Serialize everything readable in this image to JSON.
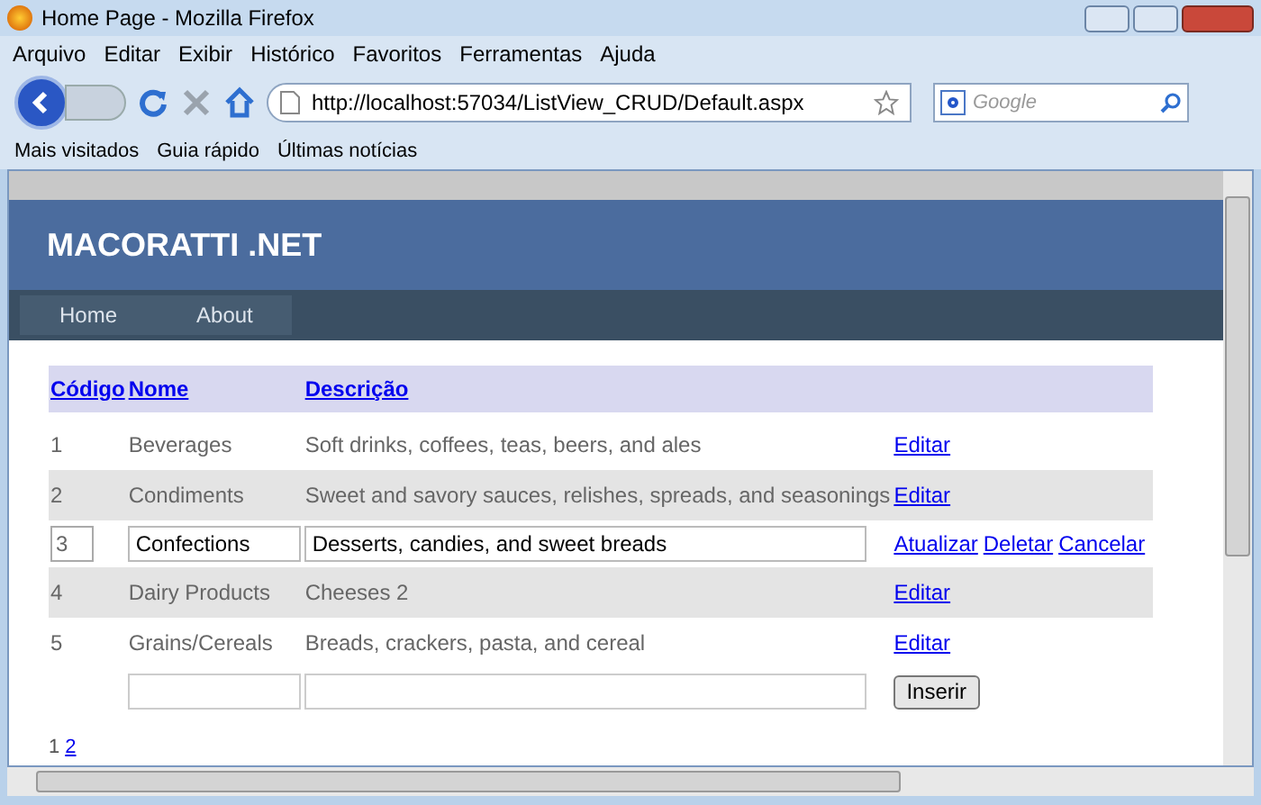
{
  "window": {
    "title": "Home Page - Mozilla Firefox"
  },
  "menu": [
    "Arquivo",
    "Editar",
    "Exibir",
    "Histórico",
    "Favoritos",
    "Ferramentas",
    "Ajuda"
  ],
  "address_bar": {
    "value": "http://localhost:57034/ListView_CRUD/Default.aspx"
  },
  "search": {
    "placeholder": "Google"
  },
  "bookmarks": [
    "Mais visitados",
    "Guia rápido",
    "Últimas notícias"
  ],
  "site": {
    "logo": "MACORATTI .NET",
    "nav": [
      "Home",
      "About"
    ]
  },
  "table": {
    "columns": [
      "Código",
      "Nome",
      "Descrição"
    ],
    "rows": [
      {
        "kind": "view",
        "shaded": false,
        "cells": [
          "1",
          "Beverages",
          "Soft drinks, coffees, teas, beers, and ales"
        ],
        "actions": [
          "Editar"
        ]
      },
      {
        "kind": "view",
        "shaded": true,
        "cells": [
          "2",
          "Condiments",
          "Sweet and savory sauces, relishes, spreads, and seasonings"
        ],
        "actions": [
          "Editar"
        ]
      },
      {
        "kind": "edit",
        "shaded": false,
        "cells": [
          "3",
          "Confections",
          "Desserts, candies, and sweet breads"
        ],
        "actions": [
          "Atualizar",
          "Deletar",
          "Cancelar"
        ]
      },
      {
        "kind": "view",
        "shaded": true,
        "cells": [
          "4",
          "Dairy Products",
          "Cheeses 2"
        ],
        "actions": [
          "Editar"
        ]
      },
      {
        "kind": "view",
        "shaded": false,
        "cells": [
          "5",
          "Grains/Cereals",
          "Breads, crackers, pasta, and cereal"
        ],
        "actions": [
          "Editar"
        ]
      },
      {
        "kind": "insert",
        "shaded": false,
        "button": "Inserir"
      }
    ]
  },
  "pager": [
    {
      "label": "1",
      "selected": true
    },
    {
      "label": "2",
      "selected": false
    }
  ]
}
